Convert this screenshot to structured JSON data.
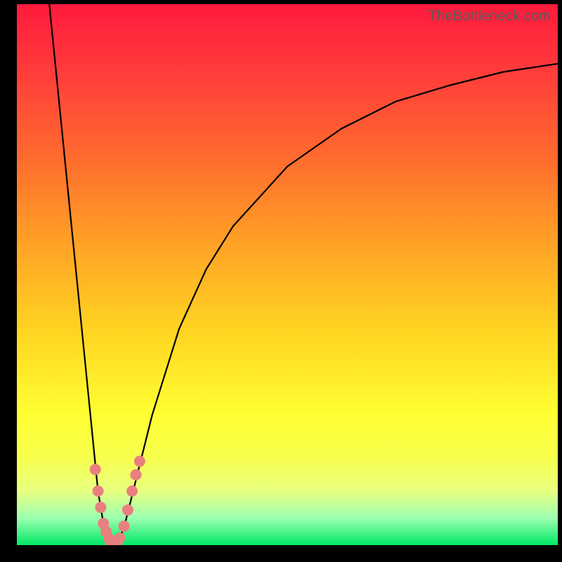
{
  "watermark": "TheBottleneck.com",
  "chart_data": {
    "type": "line",
    "title": "",
    "xlabel": "",
    "ylabel": "",
    "xlim": [
      0,
      100
    ],
    "ylim": [
      0,
      100
    ],
    "grid": false,
    "legend": false,
    "series": [
      {
        "name": "bottleneck-curve",
        "x": [
          6,
          8,
          10,
          12,
          14,
          15,
          16,
          17,
          18,
          19,
          20,
          22,
          25,
          30,
          35,
          40,
          50,
          60,
          70,
          80,
          90,
          100
        ],
        "y": [
          100,
          80,
          60,
          40,
          20,
          10,
          4,
          1,
          0,
          1,
          4,
          12,
          24,
          40,
          51,
          59,
          70,
          77,
          82,
          85,
          87.5,
          89
        ],
        "color": "#000000"
      }
    ],
    "markers": [
      {
        "name": "highlight-dots",
        "color": "#e98080",
        "points": [
          {
            "x": 14.5,
            "y": 14
          },
          {
            "x": 15.0,
            "y": 10
          },
          {
            "x": 15.5,
            "y": 7
          },
          {
            "x": 16.0,
            "y": 4
          },
          {
            "x": 16.5,
            "y": 2.5
          },
          {
            "x": 17.0,
            "y": 1.2
          },
          {
            "x": 17.5,
            "y": 0.4
          },
          {
            "x": 18.0,
            "y": 0
          },
          {
            "x": 18.5,
            "y": 0.3
          },
          {
            "x": 19.0,
            "y": 1.3
          },
          {
            "x": 19.8,
            "y": 3.5
          },
          {
            "x": 20.5,
            "y": 6.5
          },
          {
            "x": 21.3,
            "y": 10
          },
          {
            "x": 22.0,
            "y": 13
          },
          {
            "x": 22.7,
            "y": 15.5
          }
        ]
      }
    ]
  }
}
